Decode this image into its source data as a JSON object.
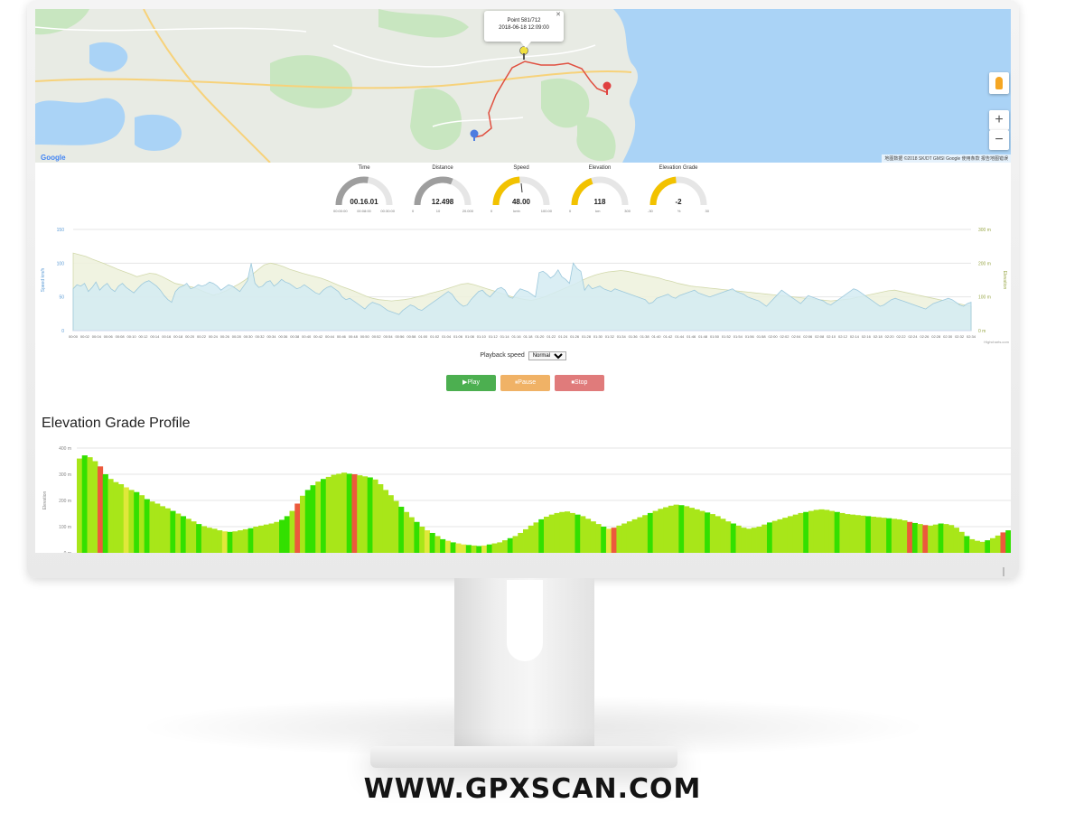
{
  "site": {
    "url": "WWW.GPXSCAN.COM"
  },
  "map": {
    "popup_line1": "Point 581/712",
    "popup_line2": "2018-06-18 12:09:00",
    "zoom_in": "+",
    "zoom_out": "−",
    "attribution": "地图数据 ©2018 SK/DT GMSI Google  使用条款  报告地图错误",
    "logo": "Google",
    "colors": {
      "water": "#aad3f6",
      "land": "#e8ebe4",
      "park": "#c8e6c0",
      "route": "#e05040"
    }
  },
  "gauges": [
    {
      "label": "Time",
      "value": "00.16.01",
      "min": "00:00:00",
      "mid": "00:08:00",
      "max": "00:30:00",
      "fraction": 0.55,
      "color": "#9e9e9e"
    },
    {
      "label": "Distance",
      "value": "12.498",
      "min": "0",
      "mid": "10",
      "max": "20.000",
      "fraction": 0.62,
      "color": "#9e9e9e"
    },
    {
      "label": "Speed",
      "value": "48.00",
      "min": "0",
      "mid": "kmh",
      "max": "100.00",
      "fraction": 0.48,
      "color": "#f2c200"
    },
    {
      "label": "Elevation",
      "value": "118",
      "min": "0",
      "mid": "km",
      "max": "300",
      "fraction": 0.4,
      "color": "#f2c200"
    },
    {
      "label": "Elevation Grade",
      "value": "-2",
      "min": "-30",
      "mid": "%",
      "max": "30",
      "fraction": 0.47,
      "color": "#f2c200"
    }
  ],
  "speed_chart": {
    "ylabel_left": "Speed km/h",
    "ylabel_right": "Elevation",
    "left_ticks": [
      "0",
      "50",
      "100",
      "150"
    ],
    "right_ticks": [
      "0 m",
      "100 m",
      "200 m",
      "300 m"
    ],
    "x_ticks": [
      "00:00",
      "00:02",
      "00:04",
      "00:06",
      "00:08",
      "00:10",
      "00:12",
      "00:14",
      "00:16",
      "00:18",
      "00:20",
      "00:22",
      "00:24",
      "00:26",
      "00:28",
      "00:30",
      "00:32",
      "00:34",
      "00:36",
      "00:38",
      "00:40",
      "00:42",
      "00:44",
      "00:46",
      "00:48",
      "00:50",
      "00:52",
      "00:54",
      "00:56",
      "00:58",
      "01:00",
      "01:02",
      "01:04",
      "01:06",
      "01:08",
      "01:10",
      "01:12",
      "01:14",
      "01:16",
      "01:18",
      "01:20",
      "01:22",
      "01:24",
      "01:26",
      "01:28",
      "01:30",
      "01:32",
      "01:34",
      "01:36",
      "01:38",
      "01:40",
      "01:42",
      "01:44",
      "01:46",
      "01:48",
      "01:50",
      "01:52",
      "01:54",
      "01:56",
      "01:58",
      "02:00",
      "02:02",
      "02:04",
      "02:06",
      "02:08",
      "02:10",
      "02:12",
      "02:14",
      "02:16",
      "02:18",
      "02:20",
      "02:22",
      "02:24",
      "02:26",
      "02:28",
      "02:30",
      "02:32",
      "02:34"
    ],
    "credit": "Highcharts.com",
    "colors": {
      "speed_fill": "#d4ebf2",
      "speed_line": "#9cc8dc",
      "elev_fill": "#edf1dc",
      "elev_line": "#d2d9ac",
      "left_axis": "#5b9bd5",
      "right_axis": "#9aa84a"
    },
    "speed": [
      62,
      68,
      66,
      70,
      58,
      64,
      72,
      60,
      66,
      70,
      62,
      58,
      66,
      70,
      64,
      60,
      56,
      62,
      68,
      72,
      74,
      70,
      66,
      60,
      52,
      46,
      42,
      58,
      64,
      66,
      70,
      62,
      64,
      68,
      66,
      68,
      72,
      70,
      66,
      60,
      64,
      68,
      66,
      62,
      58,
      66,
      74,
      100,
      70,
      64,
      66,
      72,
      74,
      66,
      70,
      76,
      72,
      70,
      66,
      62,
      64,
      68,
      64,
      60,
      56,
      54,
      60,
      64,
      66,
      62,
      58,
      50,
      46,
      48,
      44,
      40,
      36,
      32,
      38,
      42,
      40,
      38,
      34,
      30,
      28,
      26,
      24,
      30,
      34,
      38,
      36,
      32,
      30,
      34,
      38,
      42,
      46,
      50,
      54,
      58,
      54,
      46,
      40,
      36,
      38,
      46,
      52,
      58,
      60,
      54,
      50,
      56,
      62,
      64,
      60,
      50,
      48,
      56,
      62,
      60,
      58,
      54,
      50,
      86,
      88,
      84,
      78,
      82,
      90,
      80,
      76,
      70,
      100,
      92,
      88,
      60,
      68,
      62,
      64,
      66,
      62,
      60,
      58,
      62,
      60,
      58,
      56,
      54,
      52,
      50,
      48,
      46,
      40,
      42,
      48,
      50,
      52,
      54,
      50,
      48,
      52,
      54,
      56,
      58,
      60,
      56,
      54,
      52,
      50,
      52,
      54,
      56,
      58,
      60,
      62,
      58,
      56,
      54,
      50,
      48,
      46,
      44,
      40,
      36,
      42,
      48,
      54,
      60,
      56,
      52,
      48,
      44,
      40,
      46,
      52,
      50,
      48,
      46,
      44,
      40,
      38,
      42,
      46,
      50,
      54,
      58,
      62,
      60,
      56,
      52,
      48,
      44,
      40,
      36,
      38,
      42,
      46,
      48,
      46,
      44,
      42,
      40,
      38,
      36,
      34,
      32,
      36,
      40,
      42,
      44,
      46,
      48,
      46,
      42,
      38,
      36,
      40,
      42
    ],
    "elevation": [
      230,
      225,
      220,
      212,
      205,
      198,
      190,
      182,
      175,
      168,
      160,
      165,
      170,
      168,
      160,
      150,
      140,
      136,
      132,
      128,
      120,
      112,
      105,
      110,
      118,
      128,
      138,
      150,
      165,
      180,
      195,
      200,
      196,
      190,
      182,
      176,
      170,
      165,
      160,
      155,
      148,
      140,
      132,
      125,
      118,
      110,
      102,
      96,
      92,
      90,
      88,
      90,
      92,
      95,
      100,
      104,
      110,
      115,
      120,
      126,
      132,
      138,
      140,
      136,
      130,
      124,
      118,
      112,
      106,
      100,
      96,
      92,
      90,
      94,
      100,
      108,
      116,
      124,
      132,
      140,
      150,
      158,
      165,
      170,
      174,
      176,
      178,
      176,
      172,
      168,
      164,
      160,
      156,
      150,
      146,
      140,
      136,
      132,
      130,
      128,
      126,
      124,
      122,
      120,
      118,
      116,
      114,
      112,
      110,
      108,
      106,
      104,
      102,
      100,
      98,
      96,
      94,
      92,
      90,
      88,
      90,
      92,
      94,
      98,
      102,
      106,
      110,
      114,
      118,
      120,
      116,
      112,
      108,
      104,
      100,
      96,
      92,
      88,
      84,
      80,
      76,
      72
    ]
  },
  "playback": {
    "label": "Playback speed",
    "selected": "Normal"
  },
  "controls": {
    "play": "▶Play",
    "pause": "⏸Pause",
    "stop": "⏹Stop"
  },
  "grade_chart": {
    "title": "Elevation Grade Profile",
    "ylabel": "Elevation",
    "y_ticks": [
      "0 m",
      "100 m",
      "200 m",
      "300 m",
      "400 m"
    ],
    "colors": {
      "green": "#33e000",
      "lime": "#a8e619",
      "yellow": "#e0e83a",
      "red": "#ec5a3c",
      "grid": "#e6e6e6"
    },
    "elevation": [
      360,
      372,
      365,
      350,
      330,
      300,
      282,
      270,
      262,
      250,
      240,
      232,
      220,
      205,
      196,
      188,
      178,
      170,
      160,
      150,
      140,
      130,
      120,
      110,
      102,
      96,
      92,
      86,
      82,
      80,
      82,
      86,
      90,
      94,
      100,
      104,
      108,
      112,
      118,
      126,
      140,
      160,
      188,
      218,
      240,
      258,
      272,
      282,
      290,
      298,
      302,
      306,
      302,
      300,
      296,
      292,
      288,
      280,
      262,
      240,
      220,
      198,
      176,
      156,
      136,
      118,
      100,
      86,
      76,
      64,
      52,
      46,
      40,
      36,
      32,
      30,
      28,
      26,
      28,
      32,
      36,
      40,
      48,
      56,
      64,
      76,
      90,
      104,
      116,
      128,
      138,
      146,
      152,
      156,
      158,
      152,
      146,
      140,
      130,
      120,
      110,
      100,
      92,
      96,
      104,
      112,
      120,
      128,
      136,
      144,
      152,
      160,
      168,
      174,
      180,
      184,
      182,
      178,
      172,
      166,
      160,
      154,
      148,
      140,
      130,
      120,
      112,
      104,
      96,
      92,
      96,
      100,
      108,
      116,
      122,
      128,
      134,
      140,
      146,
      152,
      156,
      160,
      164,
      166,
      164,
      160,
      156,
      152,
      148,
      146,
      144,
      142,
      140,
      138,
      136,
      134,
      132,
      130,
      128,
      124,
      118,
      114,
      110,
      106,
      104,
      108,
      112,
      110,
      106,
      96,
      80,
      64,
      52,
      46,
      42,
      48,
      56,
      66,
      78,
      86
    ],
    "grade": [
      4,
      8,
      3,
      2,
      -10,
      1,
      2,
      5,
      3,
      0,
      2,
      6,
      3,
      1,
      2,
      4,
      5,
      2,
      1,
      3,
      6,
      4,
      2,
      1,
      2,
      3,
      5,
      2,
      0,
      1,
      2,
      4,
      3,
      1,
      2,
      3,
      5,
      4,
      2,
      6,
      8,
      3,
      -12,
      5,
      8,
      9,
      4,
      6,
      5,
      3,
      2,
      4,
      1,
      -10,
      3,
      2,
      1,
      2,
      4,
      3,
      5,
      2,
      1,
      3,
      2,
      1,
      2,
      0,
      1,
      2,
      1,
      0,
      1,
      0,
      0,
      1,
      2,
      1,
      0,
      1,
      2,
      3,
      4,
      6,
      5,
      3,
      2,
      4,
      5,
      6,
      3,
      2,
      4,
      3,
      5,
      2,
      1,
      2,
      3,
      4,
      2,
      1,
      0,
      -9,
      3,
      2,
      4,
      5,
      3,
      2,
      1,
      3,
      5,
      4,
      2,
      3,
      6,
      4,
      2,
      3,
      2,
      1,
      2,
      4,
      5,
      3,
      1,
      2,
      3,
      2,
      4,
      3,
      5,
      6,
      4,
      2,
      3,
      2,
      4,
      5,
      6,
      3,
      2,
      4,
      3,
      2,
      1,
      2,
      3,
      4,
      3,
      2,
      1,
      2,
      3,
      2,
      1,
      2,
      3,
      2,
      -8,
      1,
      2,
      -11,
      3,
      2,
      1,
      2,
      4,
      3,
      2,
      1,
      2,
      3
    ]
  }
}
